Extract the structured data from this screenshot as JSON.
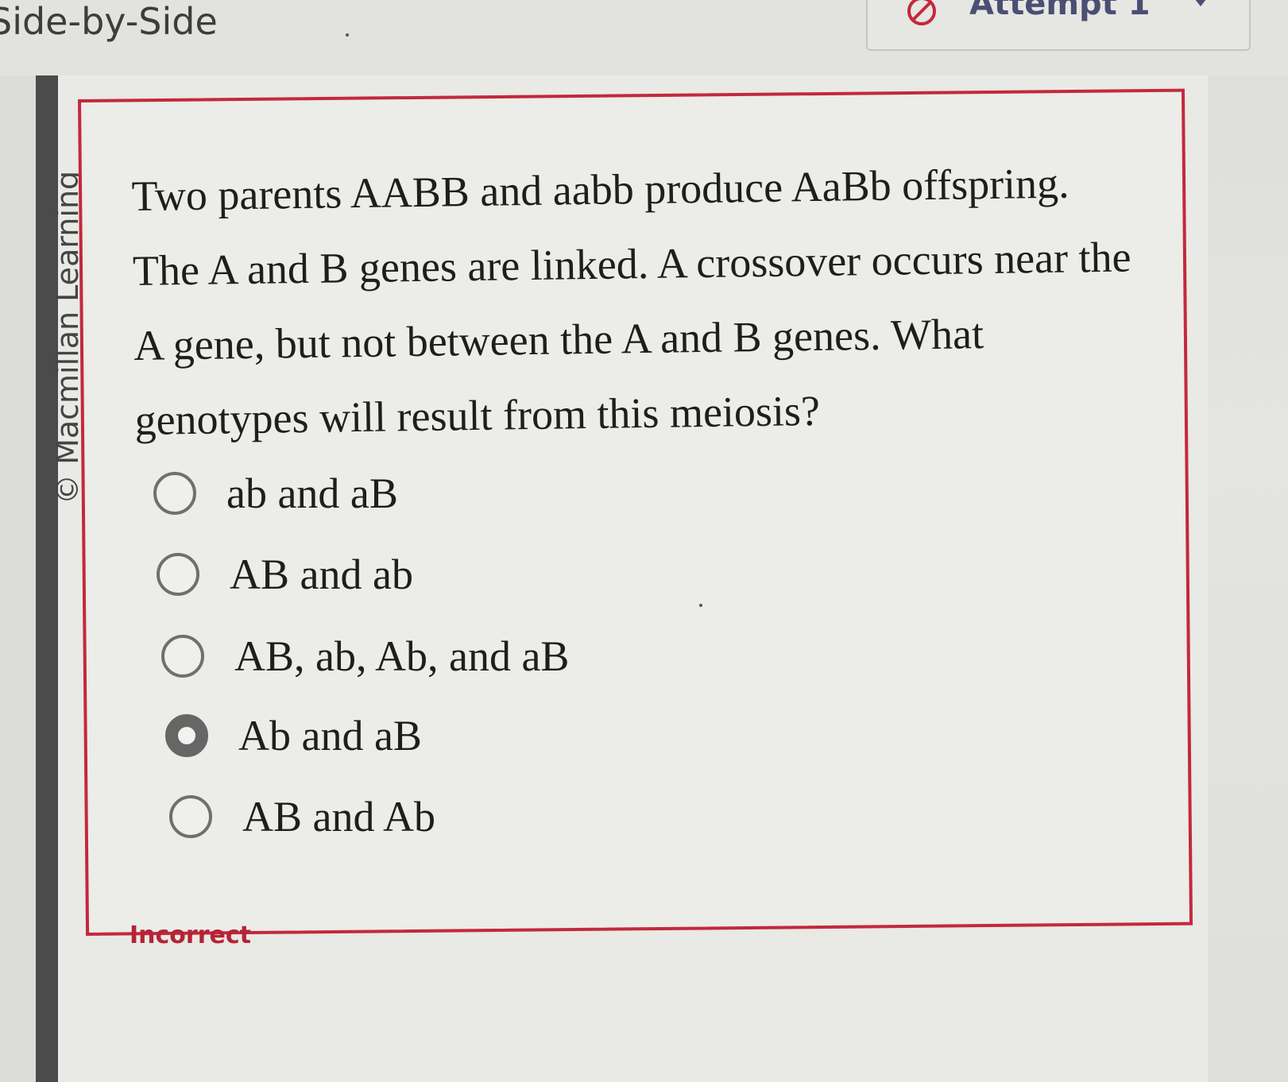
{
  "header": {
    "title": "Side-by-Side",
    "attempt_label": "Attempt 1"
  },
  "sidebar": {
    "copyright": "© Macmillan Learning"
  },
  "question": {
    "text": "Two parents AABB and aabb produce AaBb offspring. The A and B genes are linked. A crossover occurs near the A gene, but not between the A and B genes. What genotypes will result from this meiosis?",
    "options": [
      {
        "label": "ab and aB",
        "selected": false
      },
      {
        "label": "AB and ab",
        "selected": false
      },
      {
        "label": "AB, ab, Ab, and aB",
        "selected": false
      },
      {
        "label": "Ab and aB",
        "selected": true
      },
      {
        "label": "AB and Ab",
        "selected": false
      }
    ]
  },
  "feedback": {
    "status": "Incorrect"
  },
  "colors": {
    "error": "#c4283c",
    "attempt": "#4a4f73",
    "feedback_text": "#b32436"
  }
}
